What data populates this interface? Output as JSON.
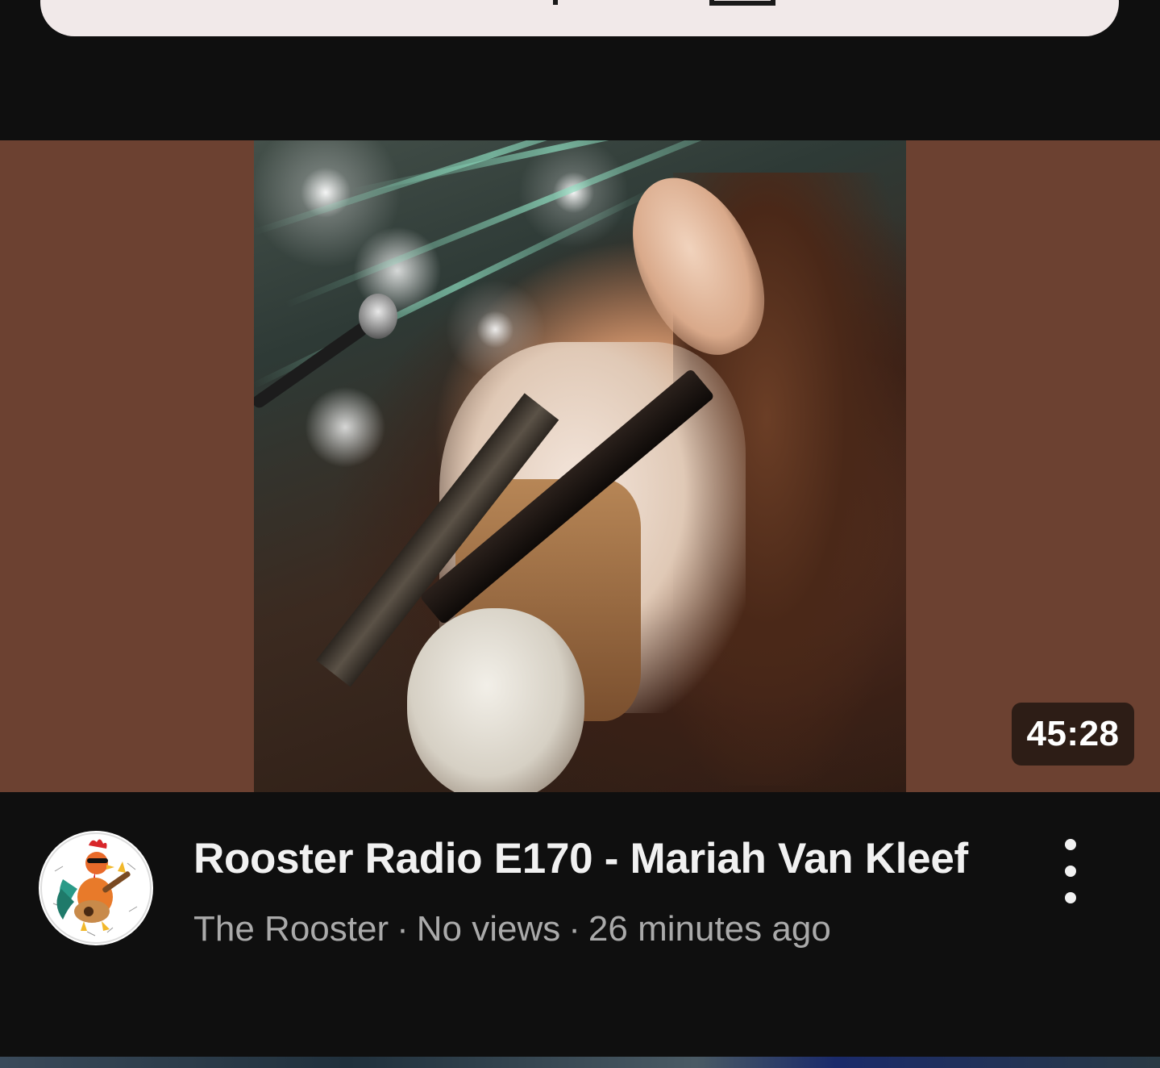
{
  "video": {
    "duration": "45:28",
    "title": "Rooster Radio E170 - Mariah Van Kleef",
    "channel": "The Rooster",
    "separator": "·",
    "views": "No views",
    "age": "26 minutes ago"
  },
  "icons": {
    "menu": "more-vert-icon",
    "avatar": "rooster-channel-avatar"
  },
  "colors": {
    "background": "#0f0f0f",
    "thumbnail_fill": "#6c4131",
    "title_text": "#f1f1f1",
    "meta_text": "#aaaaaa"
  }
}
